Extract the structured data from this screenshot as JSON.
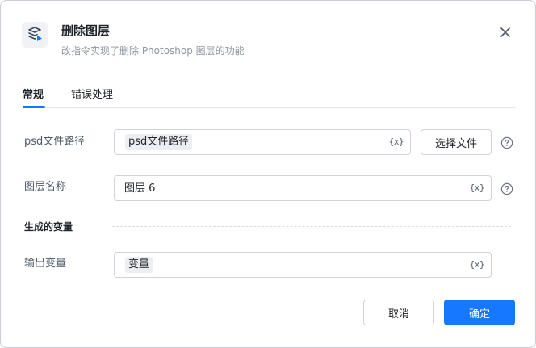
{
  "dialog": {
    "title": "删除图层",
    "subtitle": "改指令实现了删除 Photoshop 图层的功能"
  },
  "tabs": [
    {
      "label": "常规",
      "active": true
    },
    {
      "label": "错误处理",
      "active": false
    }
  ],
  "form": {
    "psd_path": {
      "label": "psd文件路径",
      "value": "psd文件路径",
      "var_icon": "{x}"
    },
    "choose_file_label": "选择文件",
    "layer_name": {
      "label": "图层名称",
      "value": "图层 6",
      "var_icon": "{x}"
    },
    "section_title": "生成的变量",
    "output_var": {
      "label": "输出变量",
      "value": "变量",
      "var_icon": "{x}"
    }
  },
  "footer": {
    "cancel_label": "取消",
    "ok_label": "确定"
  },
  "colors": {
    "primary": "#1677ff",
    "border": "#d0d3d9",
    "label": "#4e5969"
  },
  "icons": {
    "header": "layers-delete-icon",
    "close": "close-icon",
    "help": "help-circle-icon",
    "variable": "variable-icon"
  }
}
